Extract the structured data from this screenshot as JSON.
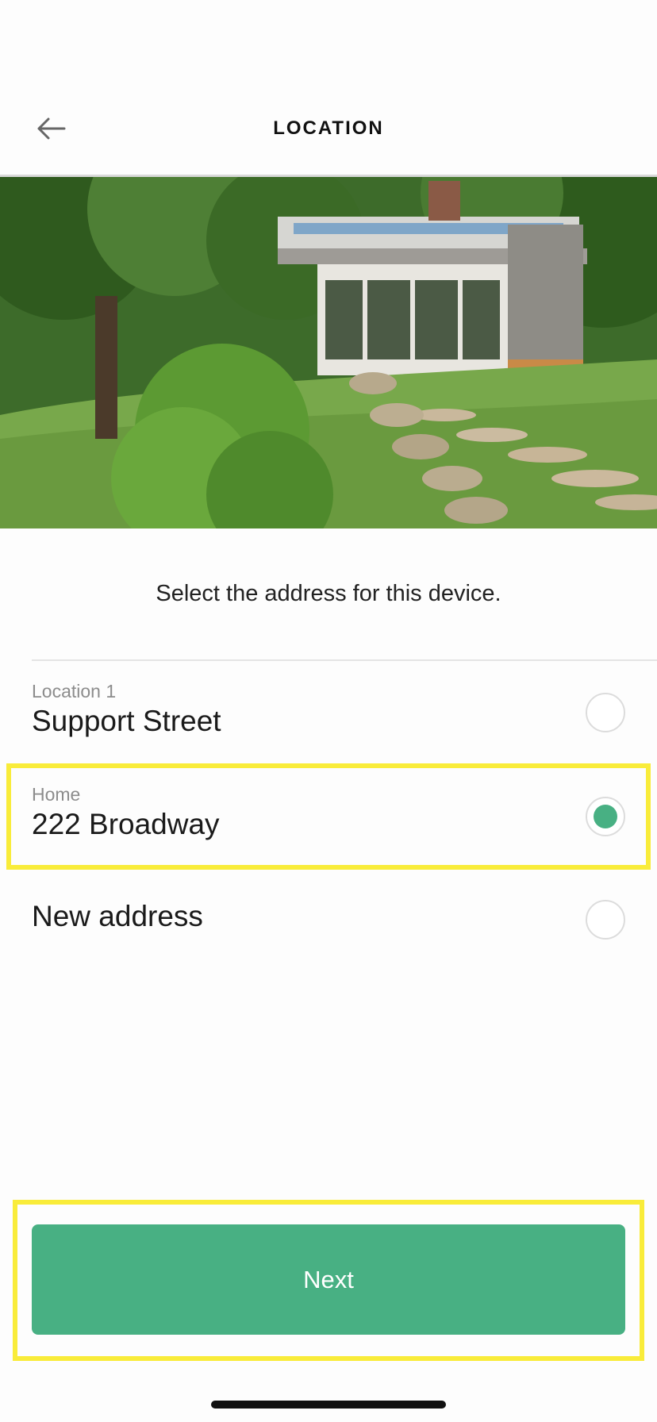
{
  "header": {
    "title": "LOCATION",
    "back_icon": "arrow-left-icon"
  },
  "hero": {
    "image": "house-photo"
  },
  "instruction": "Select the address for this device.",
  "options": [
    {
      "label": "Location 1",
      "address": "Support Street",
      "selected": false
    },
    {
      "label": "Home",
      "address": "222 Broadway",
      "selected": true
    },
    {
      "label": "",
      "address": "New address",
      "selected": false
    }
  ],
  "next_button": {
    "label": "Next"
  },
  "colors": {
    "accent": "#48b083",
    "highlight": "#f9ec3a"
  }
}
